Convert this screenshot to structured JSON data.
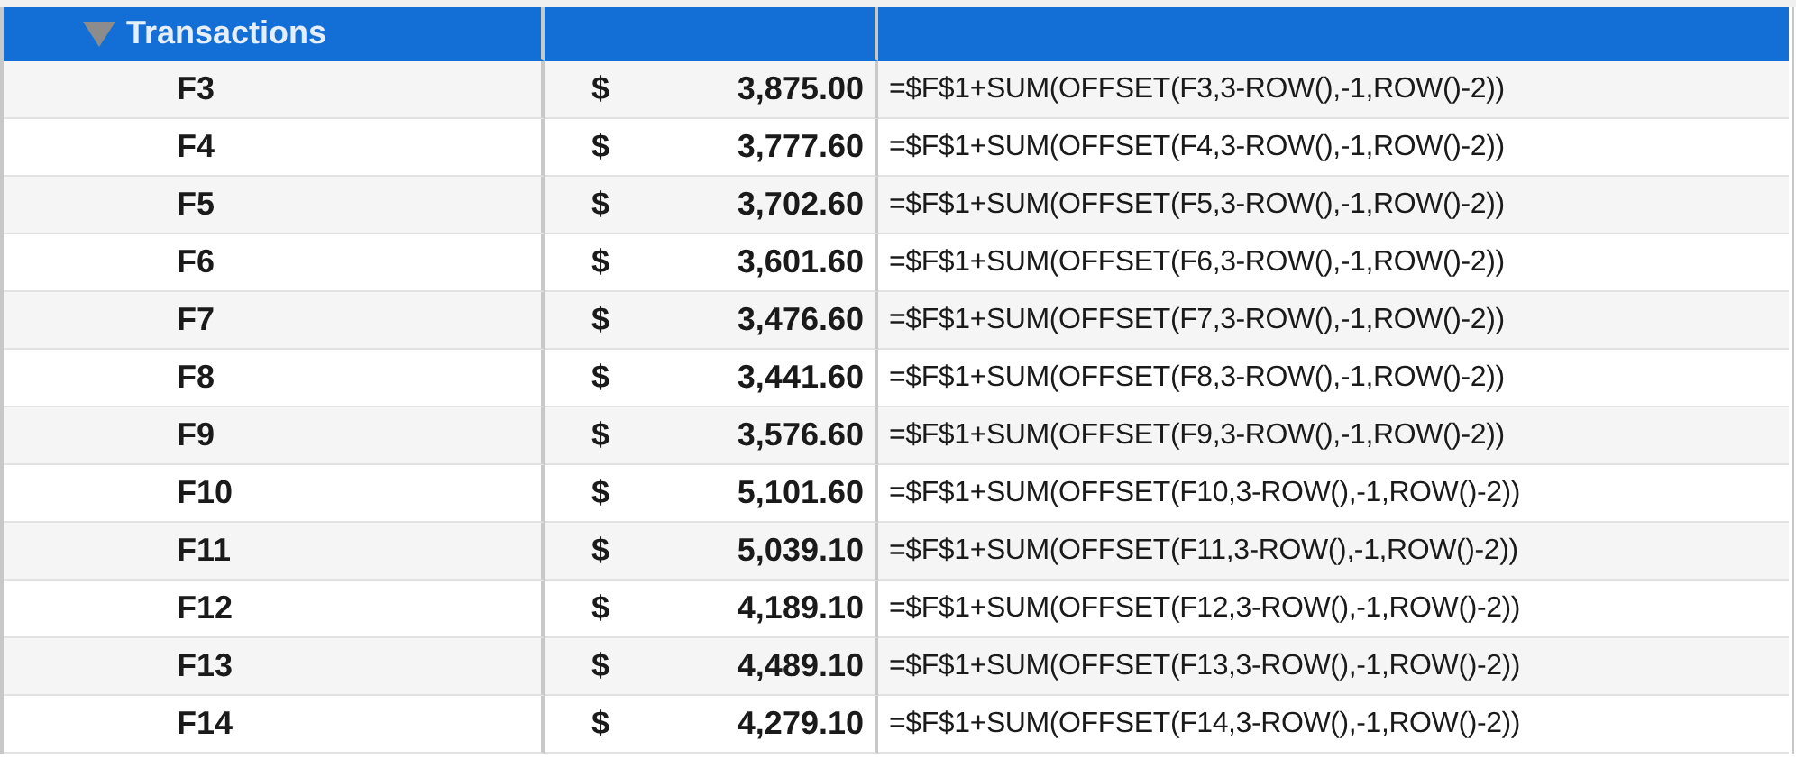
{
  "group": {
    "label": "Transactions",
    "expanded": true,
    "selected": true
  },
  "rows": [
    {
      "cell": "F3",
      "currency": "$",
      "amount": "3,875.00",
      "formula": "=$F$1+SUM(OFFSET(F3,3-ROW(),-1,ROW()-2))"
    },
    {
      "cell": "F4",
      "currency": "$",
      "amount": "3,777.60",
      "formula": "=$F$1+SUM(OFFSET(F4,3-ROW(),-1,ROW()-2))"
    },
    {
      "cell": "F5",
      "currency": "$",
      "amount": "3,702.60",
      "formula": "=$F$1+SUM(OFFSET(F5,3-ROW(),-1,ROW()-2))"
    },
    {
      "cell": "F6",
      "currency": "$",
      "amount": "3,601.60",
      "formula": "=$F$1+SUM(OFFSET(F6,3-ROW(),-1,ROW()-2))"
    },
    {
      "cell": "F7",
      "currency": "$",
      "amount": "3,476.60",
      "formula": "=$F$1+SUM(OFFSET(F7,3-ROW(),-1,ROW()-2))"
    },
    {
      "cell": "F8",
      "currency": "$",
      "amount": "3,441.60",
      "formula": "=$F$1+SUM(OFFSET(F8,3-ROW(),-1,ROW()-2))"
    },
    {
      "cell": "F9",
      "currency": "$",
      "amount": "3,576.60",
      "formula": "=$F$1+SUM(OFFSET(F9,3-ROW(),-1,ROW()-2))"
    },
    {
      "cell": "F10",
      "currency": "$",
      "amount": "5,101.60",
      "formula": "=$F$1+SUM(OFFSET(F10,3-ROW(),-1,ROW()-2))"
    },
    {
      "cell": "F11",
      "currency": "$",
      "amount": "5,039.10",
      "formula": "=$F$1+SUM(OFFSET(F11,3-ROW(),-1,ROW()-2))"
    },
    {
      "cell": "F12",
      "currency": "$",
      "amount": "4,189.10",
      "formula": "=$F$1+SUM(OFFSET(F12,3-ROW(),-1,ROW()-2))"
    },
    {
      "cell": "F13",
      "currency": "$",
      "amount": "4,489.10",
      "formula": "=$F$1+SUM(OFFSET(F13,3-ROW(),-1,ROW()-2))"
    },
    {
      "cell": "F14",
      "currency": "$",
      "amount": "4,279.10",
      "formula": "=$F$1+SUM(OFFSET(F14,3-ROW(),-1,ROW()-2))"
    }
  ]
}
